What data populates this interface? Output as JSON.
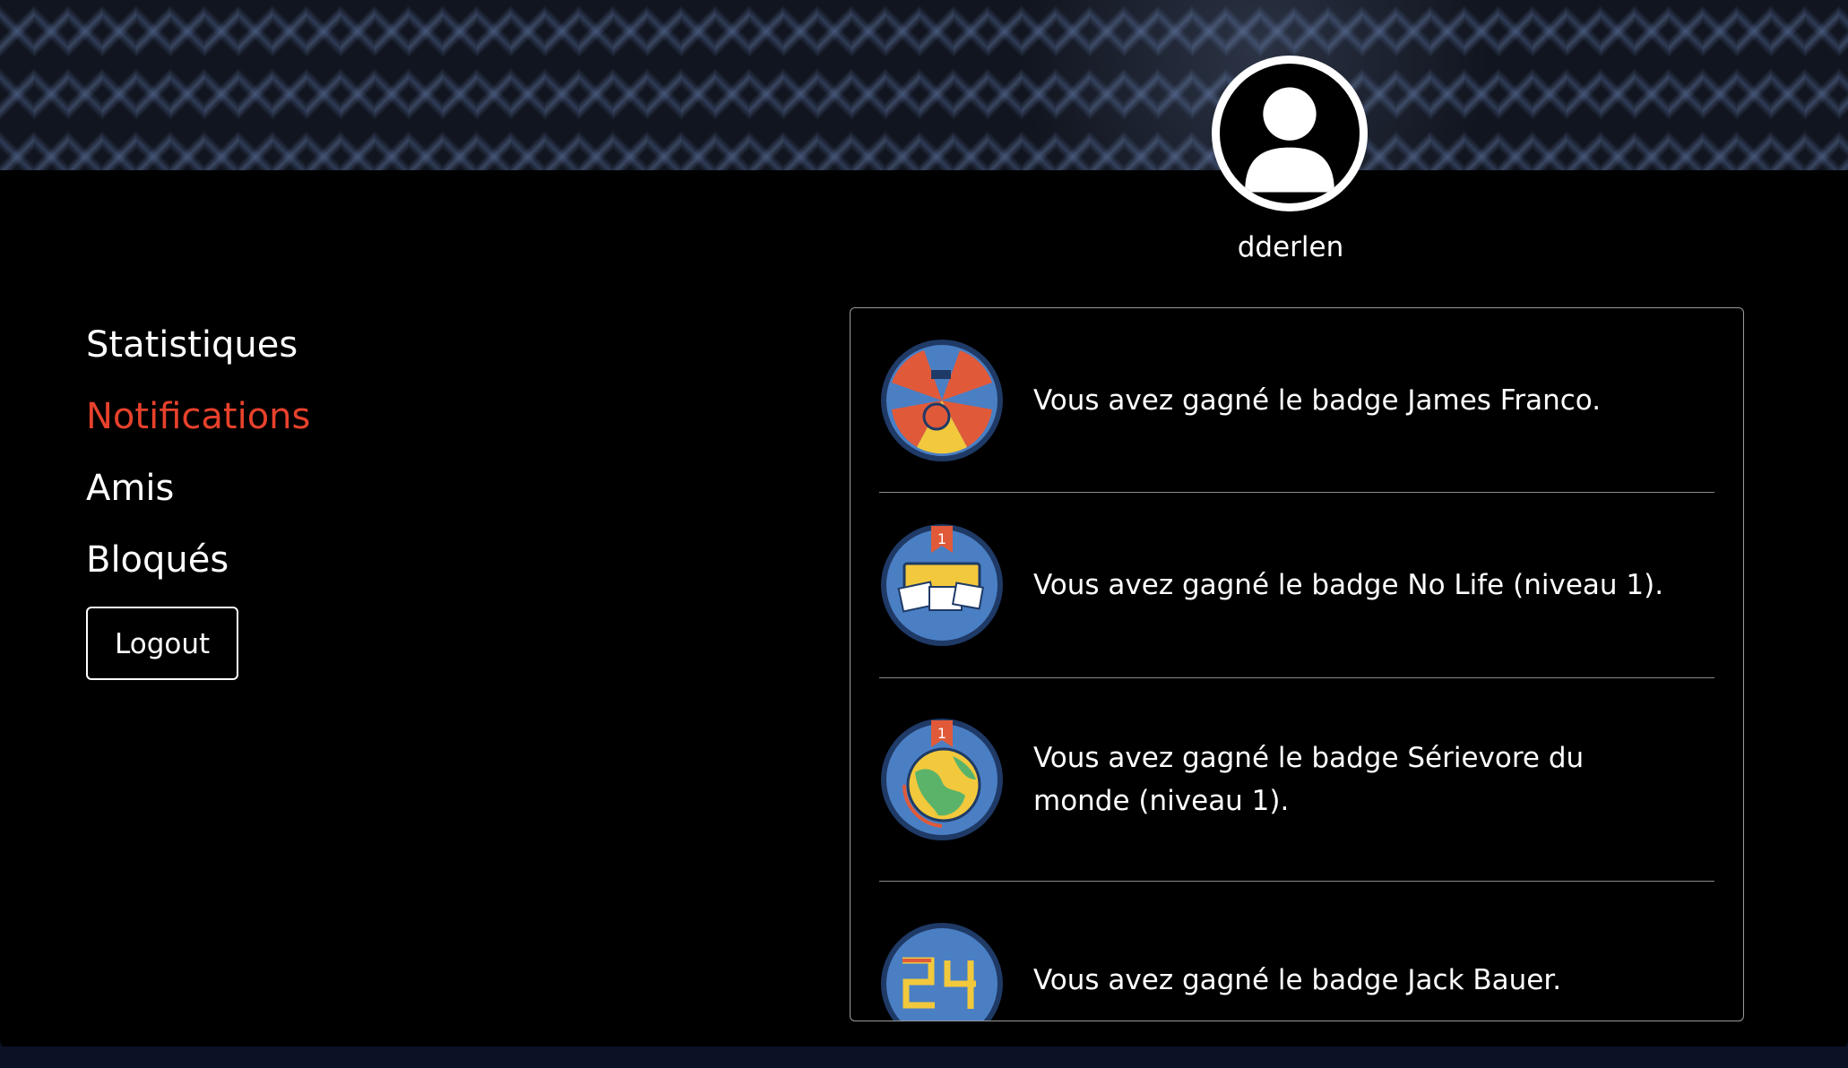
{
  "profile": {
    "username": "dderlen"
  },
  "sidebar": {
    "items": [
      {
        "label": "Statistiques",
        "active": false
      },
      {
        "label": "Notifications",
        "active": true
      },
      {
        "label": "Amis",
        "active": false
      },
      {
        "label": "Bloqués",
        "active": false
      }
    ],
    "logout_label": "Logout"
  },
  "notifications": [
    {
      "text": "Vous avez gagné le badge James Franco.",
      "badge_icon": "james-franco-badge-icon"
    },
    {
      "text": "Vous avez gagné le badge No Life (niveau 1).",
      "badge_icon": "no-life-badge-icon"
    },
    {
      "text": "Vous avez gagné le badge Sérievore du monde (niveau 1).",
      "badge_icon": "globe-badge-icon"
    },
    {
      "text": "Vous avez gagné le badge Jack Bauer.",
      "badge_icon": "jack-bauer-24-badge-icon"
    }
  ],
  "colors": {
    "active_nav": "#e8412c",
    "background": "#000000",
    "text": "#ffffff",
    "badge_blue": "#4a7fc4",
    "badge_ring": "#1f3a66"
  }
}
